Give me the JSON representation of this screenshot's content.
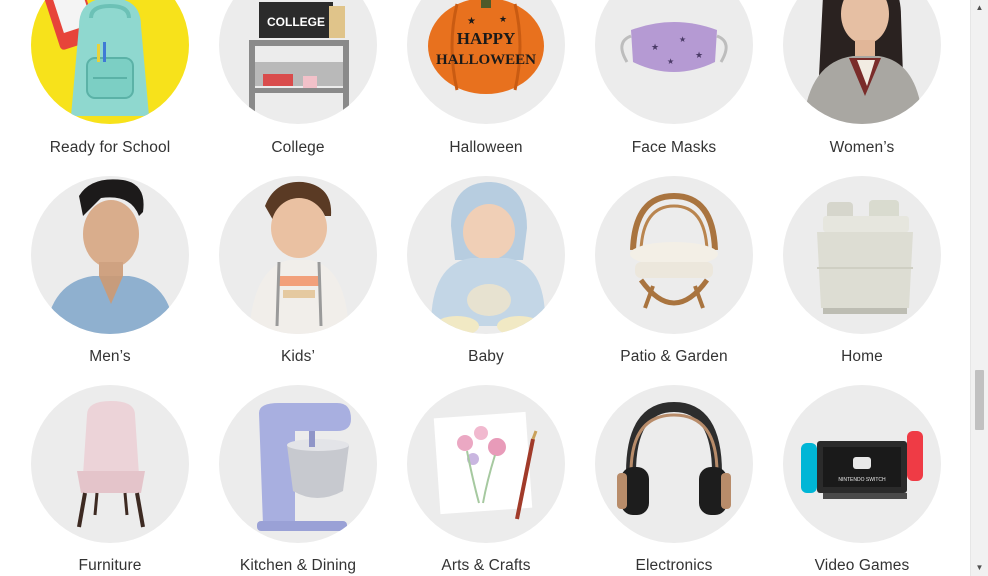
{
  "categories": [
    {
      "label": "Ready for School",
      "icon": "backpack-icon"
    },
    {
      "label": "College",
      "icon": "dorm-cart-icon",
      "sign_text": "COLLEGE"
    },
    {
      "label": "Halloween",
      "icon": "pumpkin-icon",
      "pumpkin_text_1": "HAPPY",
      "pumpkin_text_2": "HALLOWEEN"
    },
    {
      "label": "Face Masks",
      "icon": "face-mask-icon"
    },
    {
      "label": "Women’s",
      "icon": "woman-model-icon"
    },
    {
      "label": "Men’s",
      "icon": "man-model-icon"
    },
    {
      "label": "Kids’",
      "icon": "child-model-icon"
    },
    {
      "label": "Baby",
      "icon": "baby-model-icon"
    },
    {
      "label": "Patio & Garden",
      "icon": "rattan-chair-icon"
    },
    {
      "label": "Home",
      "icon": "bed-icon"
    },
    {
      "label": "Furniture",
      "icon": "accent-chair-icon"
    },
    {
      "label": "Kitchen & Dining",
      "icon": "stand-mixer-icon"
    },
    {
      "label": "Arts & Crafts",
      "icon": "watercolor-icon"
    },
    {
      "label": "Electronics",
      "icon": "headphones-icon"
    },
    {
      "label": "Video Games",
      "icon": "game-console-icon",
      "console_text": "NINTENDO SWITCH"
    }
  ],
  "scrollbar": {
    "up_arrow": "▲",
    "down_arrow": "▼"
  },
  "colors": {
    "label_text": "#333333",
    "circle_bg": "#ececec",
    "school_bg": "#f7e21b"
  }
}
